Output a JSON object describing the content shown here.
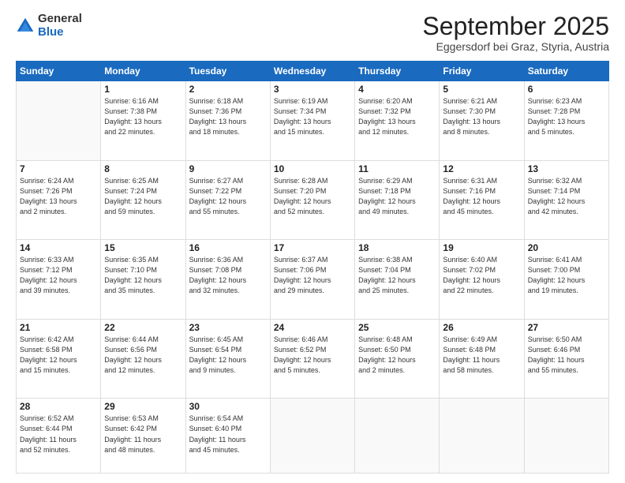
{
  "logo": {
    "general": "General",
    "blue": "Blue"
  },
  "title": "September 2025",
  "location": "Eggersdorf bei Graz, Styria, Austria",
  "days_header": [
    "Sunday",
    "Monday",
    "Tuesday",
    "Wednesday",
    "Thursday",
    "Friday",
    "Saturday"
  ],
  "weeks": [
    [
      {
        "day": "",
        "info": ""
      },
      {
        "day": "1",
        "info": "Sunrise: 6:16 AM\nSunset: 7:38 PM\nDaylight: 13 hours\nand 22 minutes."
      },
      {
        "day": "2",
        "info": "Sunrise: 6:18 AM\nSunset: 7:36 PM\nDaylight: 13 hours\nand 18 minutes."
      },
      {
        "day": "3",
        "info": "Sunrise: 6:19 AM\nSunset: 7:34 PM\nDaylight: 13 hours\nand 15 minutes."
      },
      {
        "day": "4",
        "info": "Sunrise: 6:20 AM\nSunset: 7:32 PM\nDaylight: 13 hours\nand 12 minutes."
      },
      {
        "day": "5",
        "info": "Sunrise: 6:21 AM\nSunset: 7:30 PM\nDaylight: 13 hours\nand 8 minutes."
      },
      {
        "day": "6",
        "info": "Sunrise: 6:23 AM\nSunset: 7:28 PM\nDaylight: 13 hours\nand 5 minutes."
      }
    ],
    [
      {
        "day": "7",
        "info": "Sunrise: 6:24 AM\nSunset: 7:26 PM\nDaylight: 13 hours\nand 2 minutes."
      },
      {
        "day": "8",
        "info": "Sunrise: 6:25 AM\nSunset: 7:24 PM\nDaylight: 12 hours\nand 59 minutes."
      },
      {
        "day": "9",
        "info": "Sunrise: 6:27 AM\nSunset: 7:22 PM\nDaylight: 12 hours\nand 55 minutes."
      },
      {
        "day": "10",
        "info": "Sunrise: 6:28 AM\nSunset: 7:20 PM\nDaylight: 12 hours\nand 52 minutes."
      },
      {
        "day": "11",
        "info": "Sunrise: 6:29 AM\nSunset: 7:18 PM\nDaylight: 12 hours\nand 49 minutes."
      },
      {
        "day": "12",
        "info": "Sunrise: 6:31 AM\nSunset: 7:16 PM\nDaylight: 12 hours\nand 45 minutes."
      },
      {
        "day": "13",
        "info": "Sunrise: 6:32 AM\nSunset: 7:14 PM\nDaylight: 12 hours\nand 42 minutes."
      }
    ],
    [
      {
        "day": "14",
        "info": "Sunrise: 6:33 AM\nSunset: 7:12 PM\nDaylight: 12 hours\nand 39 minutes."
      },
      {
        "day": "15",
        "info": "Sunrise: 6:35 AM\nSunset: 7:10 PM\nDaylight: 12 hours\nand 35 minutes."
      },
      {
        "day": "16",
        "info": "Sunrise: 6:36 AM\nSunset: 7:08 PM\nDaylight: 12 hours\nand 32 minutes."
      },
      {
        "day": "17",
        "info": "Sunrise: 6:37 AM\nSunset: 7:06 PM\nDaylight: 12 hours\nand 29 minutes."
      },
      {
        "day": "18",
        "info": "Sunrise: 6:38 AM\nSunset: 7:04 PM\nDaylight: 12 hours\nand 25 minutes."
      },
      {
        "day": "19",
        "info": "Sunrise: 6:40 AM\nSunset: 7:02 PM\nDaylight: 12 hours\nand 22 minutes."
      },
      {
        "day": "20",
        "info": "Sunrise: 6:41 AM\nSunset: 7:00 PM\nDaylight: 12 hours\nand 19 minutes."
      }
    ],
    [
      {
        "day": "21",
        "info": "Sunrise: 6:42 AM\nSunset: 6:58 PM\nDaylight: 12 hours\nand 15 minutes."
      },
      {
        "day": "22",
        "info": "Sunrise: 6:44 AM\nSunset: 6:56 PM\nDaylight: 12 hours\nand 12 minutes."
      },
      {
        "day": "23",
        "info": "Sunrise: 6:45 AM\nSunset: 6:54 PM\nDaylight: 12 hours\nand 9 minutes."
      },
      {
        "day": "24",
        "info": "Sunrise: 6:46 AM\nSunset: 6:52 PM\nDaylight: 12 hours\nand 5 minutes."
      },
      {
        "day": "25",
        "info": "Sunrise: 6:48 AM\nSunset: 6:50 PM\nDaylight: 12 hours\nand 2 minutes."
      },
      {
        "day": "26",
        "info": "Sunrise: 6:49 AM\nSunset: 6:48 PM\nDaylight: 11 hours\nand 58 minutes."
      },
      {
        "day": "27",
        "info": "Sunrise: 6:50 AM\nSunset: 6:46 PM\nDaylight: 11 hours\nand 55 minutes."
      }
    ],
    [
      {
        "day": "28",
        "info": "Sunrise: 6:52 AM\nSunset: 6:44 PM\nDaylight: 11 hours\nand 52 minutes."
      },
      {
        "day": "29",
        "info": "Sunrise: 6:53 AM\nSunset: 6:42 PM\nDaylight: 11 hours\nand 48 minutes."
      },
      {
        "day": "30",
        "info": "Sunrise: 6:54 AM\nSunset: 6:40 PM\nDaylight: 11 hours\nand 45 minutes."
      },
      {
        "day": "",
        "info": ""
      },
      {
        "day": "",
        "info": ""
      },
      {
        "day": "",
        "info": ""
      },
      {
        "day": "",
        "info": ""
      }
    ]
  ]
}
